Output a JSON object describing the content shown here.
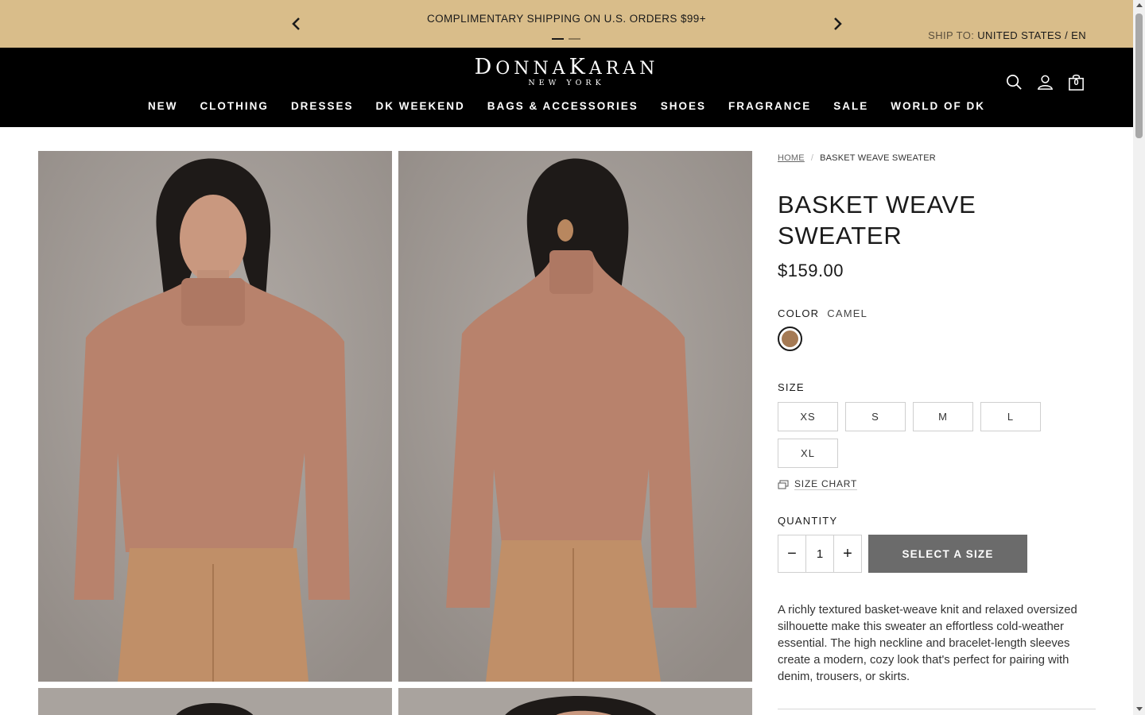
{
  "promo": {
    "message": "COMPLIMENTARY SHIPPING ON U.S. ORDERS $99+",
    "ship_to_label": "SHIP TO:",
    "ship_to_value": "UNITED STATES / EN"
  },
  "header": {
    "logo_line1_a": "D",
    "logo_line1_b": "ONNA",
    "logo_line1_c": "K",
    "logo_line1_d": "ARAN",
    "logo_line2": "NEW YORK",
    "bag_count": "0",
    "nav": [
      "NEW",
      "CLOTHING",
      "DRESSES",
      "DK WEEKEND",
      "BAGS & ACCESSORIES",
      "SHOES",
      "FRAGRANCE",
      "SALE",
      "WORLD OF DK"
    ]
  },
  "breadcrumb": {
    "home": "HOME",
    "separator": "/",
    "current": "BASKET WEAVE SWEATER"
  },
  "product": {
    "title_line1": "BASKET WEAVE",
    "title_line2": "SWEATER",
    "price": "$159.00",
    "color_label": "COLOR",
    "color_value": "CAMEL",
    "swatch_color": "#a57a54",
    "size_label": "SIZE",
    "sizes": [
      "XS",
      "S",
      "M",
      "L",
      "XL"
    ],
    "size_chart": "SIZE CHART",
    "quantity_label": "QUANTITY",
    "quantity": "1",
    "cta": "SELECT A SIZE",
    "description": "A richly textured basket-weave knit and relaxed oversized silhouette make this sweater an effortless cold-weather essential. The high neckline and bracelet-length sleeves create a modern, cozy look that's perfect for pairing with denim, trousers, or skirts."
  },
  "colors": {
    "promo_bg": "#d9bd8a",
    "header_bg": "#000000",
    "cta_bg": "#6b6b6b",
    "sweater": "#b8826c",
    "pants": "#c08f68"
  }
}
